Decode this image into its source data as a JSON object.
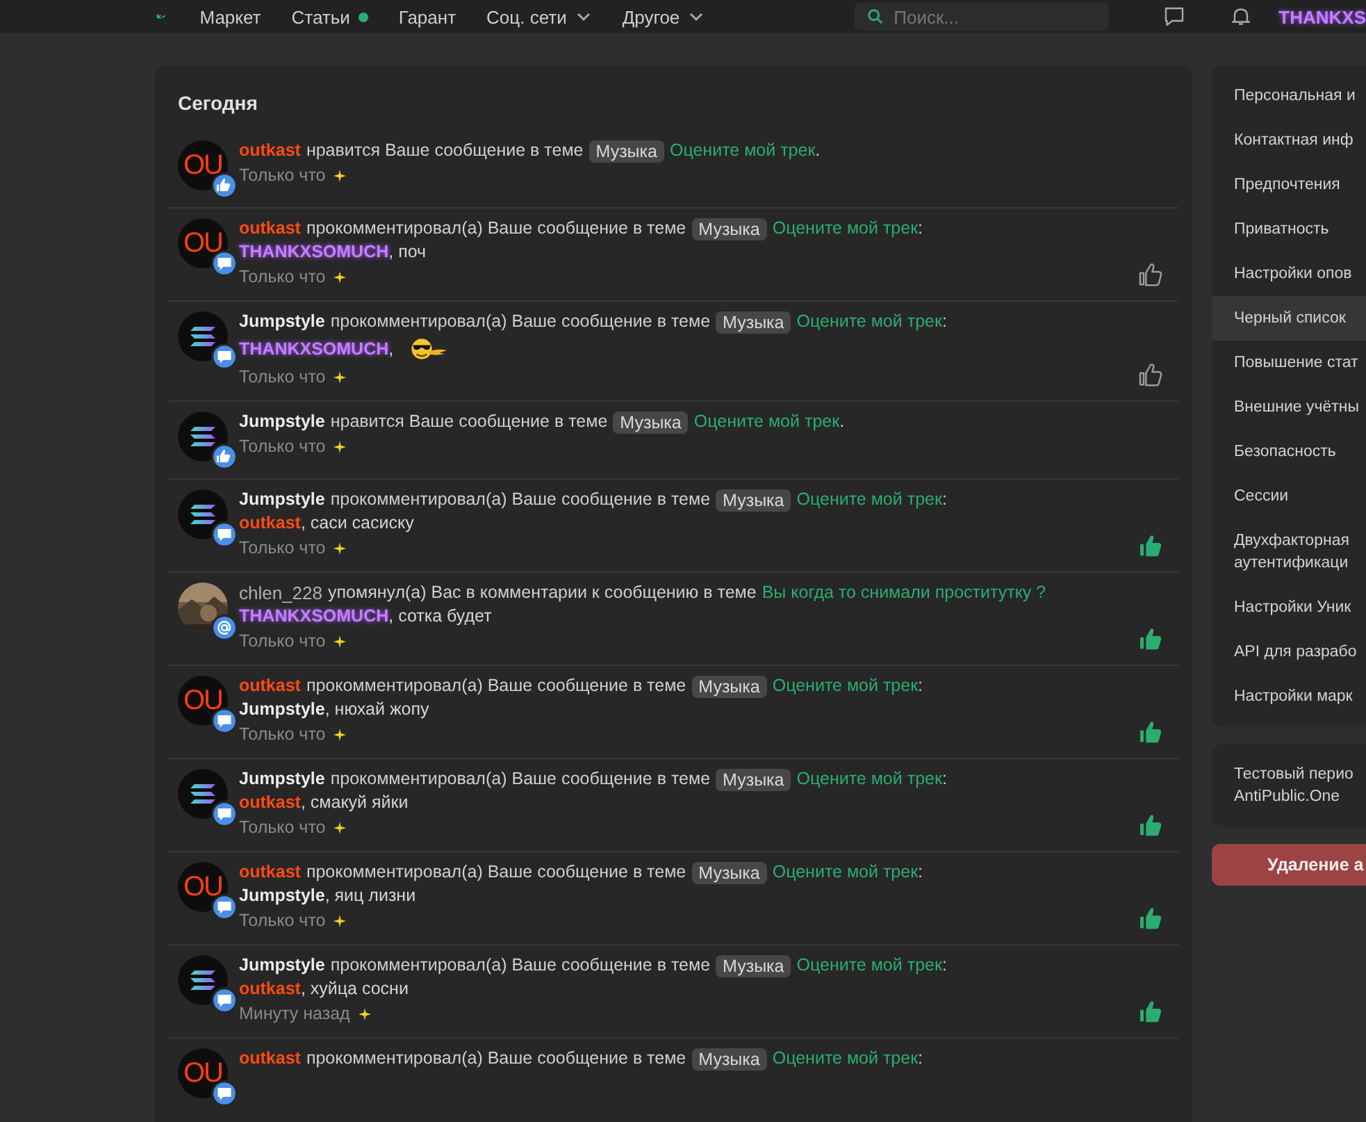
{
  "header": {
    "nav": [
      {
        "label": "Маркет",
        "dot": false,
        "dropdown": false
      },
      {
        "label": "Статьи",
        "dot": true,
        "dropdown": false
      },
      {
        "label": "Гарант",
        "dot": false,
        "dropdown": false
      },
      {
        "label": "Соц. сети",
        "dot": false,
        "dropdown": true
      },
      {
        "label": "Другое",
        "dot": false,
        "dropdown": true
      }
    ],
    "search": {
      "placeholder": "Поиск..."
    },
    "username": "THANKXS"
  },
  "notifications": {
    "title": "Сегодня",
    "items": [
      {
        "avatar": {
          "kind": "letters",
          "text": "OU",
          "badge": {
            "kind": "like"
          }
        },
        "user": {
          "name": "outkast",
          "kind": "orange"
        },
        "action": "нравится Ваше сообщение в теме",
        "tag": "Музыка",
        "thread": "Оцените мой трек",
        "end": ".",
        "time": "Только что"
      },
      {
        "avatar": {
          "kind": "letters",
          "text": "OU",
          "badge": {
            "kind": "comment"
          }
        },
        "user": {
          "name": "outkast",
          "kind": "orange"
        },
        "action": "прокомментировал(а) Ваше сообщение в теме",
        "tag": "Музыка",
        "thread": "Оцените мой трек",
        "end": ":",
        "reply": {
          "user": {
            "name": "THANKXSOMUCH",
            "kind": "glow"
          },
          "text": ", поч"
        },
        "time": "Только что",
        "liked": false
      },
      {
        "avatar": {
          "kind": "logo",
          "badge": {
            "kind": "comment"
          }
        },
        "user": {
          "name": "Jumpstyle",
          "kind": "white"
        },
        "action": "прокомментировал(а) Ваше сообщение в теме",
        "tag": "Музыка",
        "thread": "Оцените мой трек",
        "end": ":",
        "reply": {
          "user": {
            "name": "THANKXSOMUCH",
            "kind": "glow"
          },
          "text": ",",
          "emoji": true
        },
        "time": "Только что",
        "liked": false
      },
      {
        "avatar": {
          "kind": "logo",
          "badge": {
            "kind": "like"
          }
        },
        "user": {
          "name": "Jumpstyle",
          "kind": "white"
        },
        "action": "нравится Ваше сообщение в теме",
        "tag": "Музыка",
        "thread": "Оцените мой трек",
        "end": ".",
        "time": "Только что"
      },
      {
        "avatar": {
          "kind": "logo",
          "badge": {
            "kind": "comment"
          }
        },
        "user": {
          "name": "Jumpstyle",
          "kind": "white"
        },
        "action": "прокомментировал(а) Ваше сообщение в теме",
        "tag": "Музыка",
        "thread": "Оцените мой трек",
        "end": ":",
        "reply": {
          "user": {
            "name": "outkast",
            "kind": "orange"
          },
          "text": ", саси сасиску"
        },
        "time": "Только что",
        "liked": true
      },
      {
        "avatar": {
          "kind": "picture",
          "badge": {
            "kind": "mention"
          }
        },
        "user": {
          "name": "chlen_228",
          "kind": "plain"
        },
        "action": "упомянул(а) Вас в комментарии к сообщению в теме",
        "thread": "Вы когда то снимали проститутку ?",
        "reply": {
          "user": {
            "name": "THANKXSOMUCH",
            "kind": "glow"
          },
          "text": ", сотка будет"
        },
        "time": "Только что",
        "liked": true
      },
      {
        "avatar": {
          "kind": "letters",
          "text": "OU",
          "badge": {
            "kind": "comment"
          }
        },
        "user": {
          "name": "outkast",
          "kind": "orange"
        },
        "action": "прокомментировал(а) Ваше сообщение в теме",
        "tag": "Музыка",
        "thread": "Оцените мой трек",
        "end": ":",
        "reply": {
          "user": {
            "name": "Jumpstyle",
            "kind": "white"
          },
          "text": ", нюхай жопу"
        },
        "time": "Только что",
        "liked": true
      },
      {
        "avatar": {
          "kind": "logo",
          "badge": {
            "kind": "comment"
          }
        },
        "user": {
          "name": "Jumpstyle",
          "kind": "white"
        },
        "action": "прокомментировал(а) Ваше сообщение в теме",
        "tag": "Музыка",
        "thread": "Оцените мой трек",
        "end": ":",
        "reply": {
          "user": {
            "name": "outkast",
            "kind": "orange"
          },
          "text": ", смакуй яйки"
        },
        "time": "Только что",
        "liked": true
      },
      {
        "avatar": {
          "kind": "letters",
          "text": "OU",
          "badge": {
            "kind": "comment"
          }
        },
        "user": {
          "name": "outkast",
          "kind": "orange"
        },
        "action": "прокомментировал(а) Ваше сообщение в теме",
        "tag": "Музыка",
        "thread": "Оцените мой трек",
        "end": ":",
        "reply": {
          "user": {
            "name": "Jumpstyle",
            "kind": "white"
          },
          "text": ", яиц лизни"
        },
        "time": "Только что",
        "liked": true
      },
      {
        "avatar": {
          "kind": "logo",
          "badge": {
            "kind": "comment"
          }
        },
        "user": {
          "name": "Jumpstyle",
          "kind": "white"
        },
        "action": "прокомментировал(а) Ваше сообщение в теме",
        "tag": "Музыка",
        "thread": "Оцените мой трек",
        "end": ":",
        "reply": {
          "user": {
            "name": "outkast",
            "kind": "orange"
          },
          "text": ", хуйца сосни"
        },
        "time": "Минуту назад",
        "liked": true
      },
      {
        "avatar": {
          "kind": "letters",
          "text": "OU",
          "badge": {
            "kind": "comment"
          }
        },
        "user": {
          "name": "outkast",
          "kind": "orange"
        },
        "action": "прокомментировал(а) Ваше сообщение в теме",
        "tag": "Музыка",
        "thread": "Оцените мой трек",
        "end": ":"
      }
    ]
  },
  "sidebar": {
    "groups": [
      {
        "items": [
          {
            "label": "Персональная и",
            "selected": false
          },
          {
            "label": "Контактная инф",
            "selected": false
          },
          {
            "label": "Предпочтения",
            "selected": false
          },
          {
            "label": "Приватность",
            "selected": false
          },
          {
            "label": "Настройки опов",
            "selected": false
          },
          {
            "label": "Черный список",
            "selected": true
          },
          {
            "label": "Повышение стат",
            "selected": false
          },
          {
            "label": "Внешние учётны",
            "selected": false
          },
          {
            "label": "Безопасность",
            "selected": false
          },
          {
            "label": "Сессии",
            "selected": false
          },
          {
            "label": "Двухфакторная\nаутентификаци",
            "selected": false
          },
          {
            "label": "Настройки Уник",
            "selected": false
          },
          {
            "label": "API для разрабо",
            "selected": false
          },
          {
            "label": "Настройки марк",
            "selected": false
          }
        ]
      },
      {
        "items": [
          {
            "label": "Тестовый перио\nAntiPublic.One",
            "selected": false
          }
        ]
      }
    ],
    "danger_button": "Удаление а"
  }
}
